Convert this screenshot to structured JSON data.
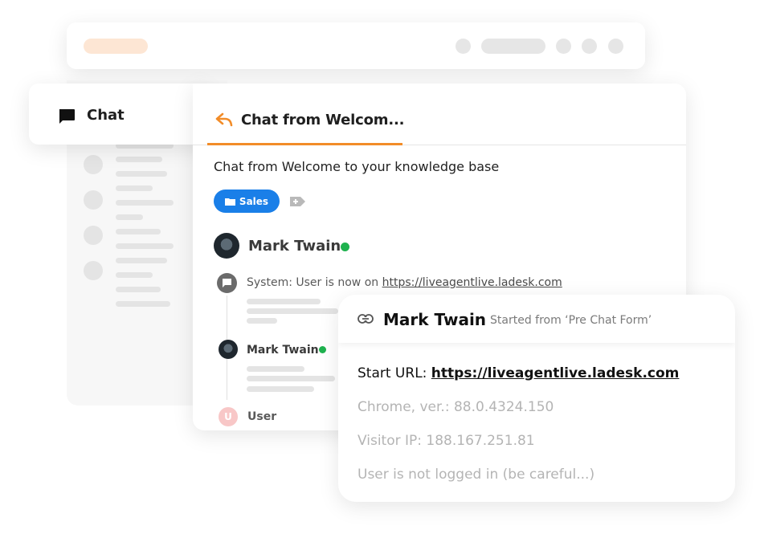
{
  "chat_tab": {
    "label": "Chat"
  },
  "conversation": {
    "tab_title": "Chat from Welcom...",
    "subject": "Chat from Welcome to your knowledge base",
    "tag": "Sales",
    "contact_name": "Mark Twain",
    "system_prefix": "System: User is now on ",
    "system_link": "https://liveagentlive.ladesk.com",
    "message_author": "Mark Twain",
    "user_initial": "U",
    "user_label": "User"
  },
  "visitor_info": {
    "name": "Mark Twain",
    "started_from": "Started from ‘Pre Chat Form’",
    "start_url_label": "Start URL: ",
    "start_url": "https://liveagentlive.ladesk.com",
    "browser": "Chrome, ver.: 88.0.4324.150",
    "ip": "Visitor IP: 188.167.251.81",
    "login_status": "User is not logged in (be careful...)"
  },
  "colors": {
    "accent": "#f28c28",
    "tag_blue": "#1a7fe8",
    "online": "#1fb24f"
  }
}
